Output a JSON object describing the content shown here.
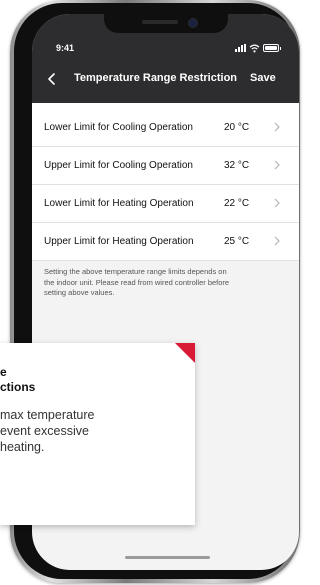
{
  "status_bar": {
    "time": "9:41",
    "icons": [
      "signal-icon",
      "wifi-icon",
      "battery-icon"
    ]
  },
  "header": {
    "back_icon": "chevron-left-icon",
    "title": "Temperature Range Restriction",
    "save_label": "Save"
  },
  "settings": {
    "rows": [
      {
        "label": "Lower Limit for Cooling Operation",
        "value": "20 °C"
      },
      {
        "label": "Upper Limit for Cooling Operation",
        "value": "32 °C"
      },
      {
        "label": "Lower Limit for Heating Operation",
        "value": "22 °C"
      },
      {
        "label": "Upper Limit for Heating Operation",
        "value": "25 °C"
      }
    ],
    "note_line1": "Setting the above temperature range limits depends on",
    "note_line2": "the indoor unit. Please read from wired controller before",
    "note_line3": "setting above values."
  },
  "callout": {
    "title_line1": "e",
    "title_line2": "ctions",
    "body_line1": "max temperature",
    "body_line2": "event excessive",
    "body_line3": "heating.",
    "accent_color": "#d81a36"
  },
  "colors": {
    "header_bg": "#2d2d2f",
    "screen_bg": "#f3f3f3"
  }
}
